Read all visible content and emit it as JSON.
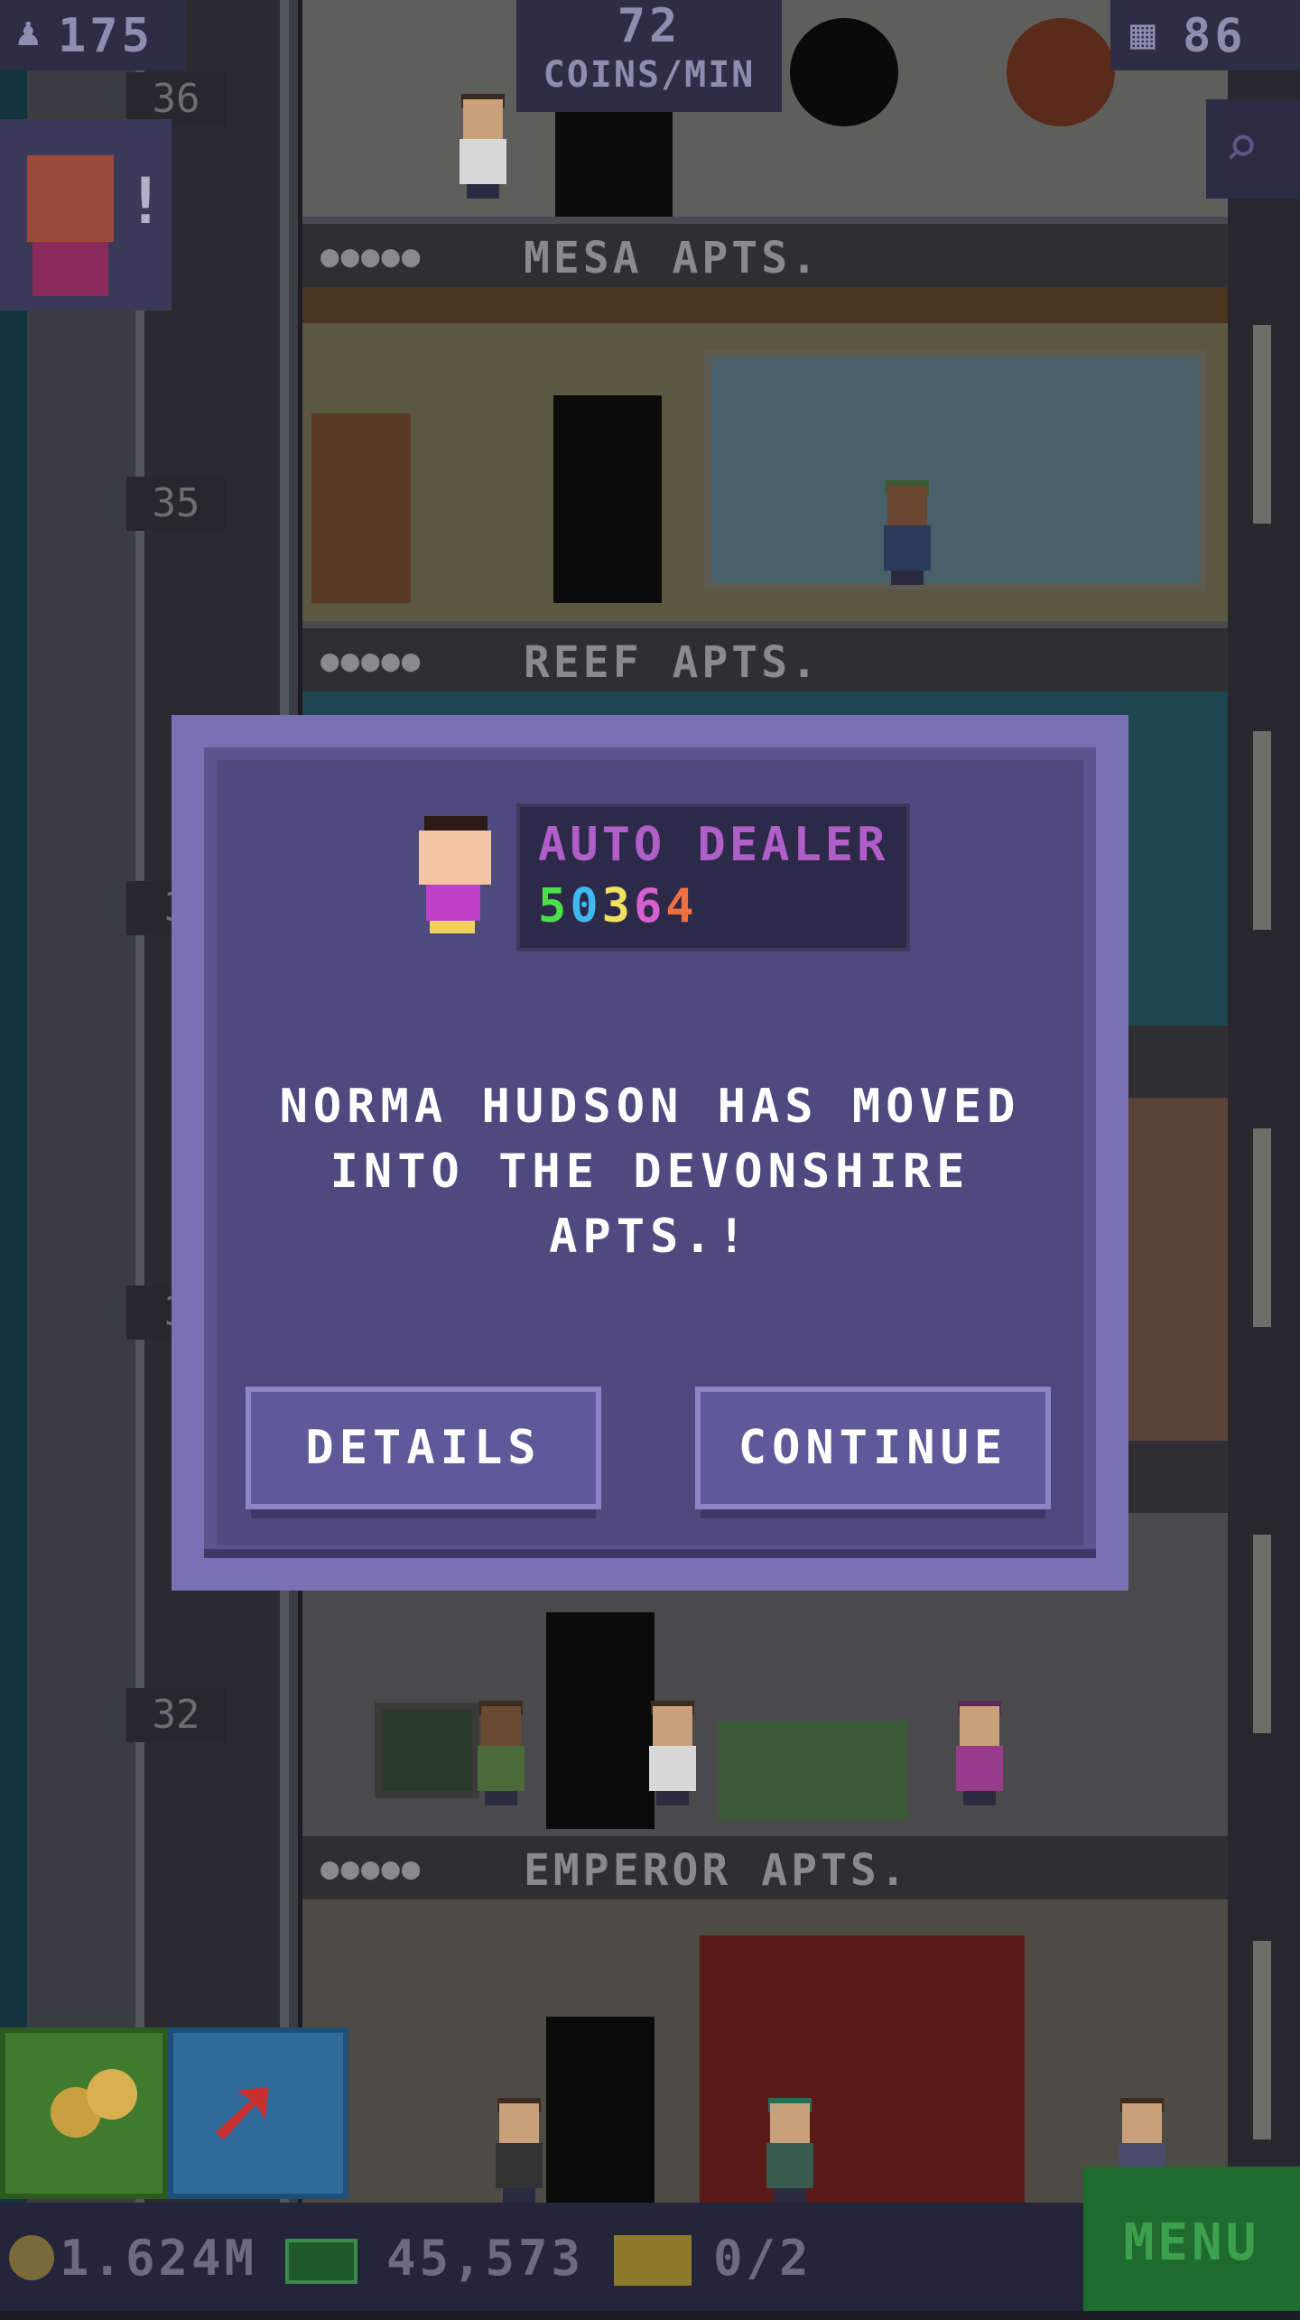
{
  "hud": {
    "population": "175",
    "coins_rate_value": "72",
    "coins_rate_unit": "COINS/MIN",
    "floors": "86"
  },
  "tower": {
    "floor_labels": [
      "36",
      "35",
      "3",
      "3",
      "32"
    ],
    "signs": [
      "MESA APTS.",
      "REEF APTS.",
      "EMPEROR APTS."
    ],
    "sign_dots": "●●●●●"
  },
  "modal": {
    "job_title": "AUTO DEALER",
    "digits": [
      {
        "d": "5",
        "color": "#4be04b"
      },
      {
        "d": "0",
        "color": "#3fb8f0"
      },
      {
        "d": "3",
        "color": "#f0e060"
      },
      {
        "d": "6",
        "color": "#d860d0"
      },
      {
        "d": "4",
        "color": "#f07040"
      }
    ],
    "message_line1": "NORMA HUDSON HAS MOVED",
    "message_line2": "INTO THE DEVONSHIRE APTS.!",
    "details_label": "DETAILS",
    "continue_label": "CONTINUE"
  },
  "bottom_bar": {
    "coins": "1.624M",
    "bux": "45,573",
    "tickets": "0/2",
    "menu_label": "MENU"
  },
  "colors": {
    "modal_border": "#7a70b4",
    "modal_fill": "#4e4a80",
    "job_color": "#b05ec8",
    "menu_green": "#1f6a2e"
  }
}
